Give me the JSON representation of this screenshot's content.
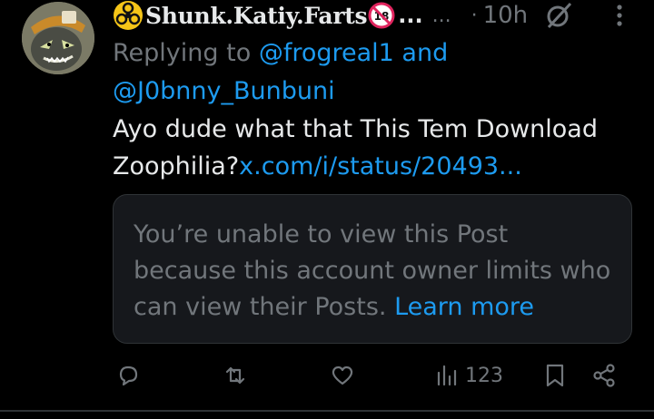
{
  "post": {
    "author_name": "Shunk.Katiy.Farts",
    "name_ellipsis": "...",
    "handle_ellipsis": "...",
    "separator": "·",
    "time": "10h",
    "replying_prefix": "Replying to ",
    "mention_1": "@frogreal1",
    "and_word": " and",
    "mention_2": "@J0bnny_Bunbuni",
    "text": "Ayo dude what that This Tem Download Zoophilia?",
    "link": "x.com/i/status/20493...",
    "icons": [
      "biohazard-icon",
      "age-18-icon",
      "grok-icon",
      "more-icon"
    ]
  },
  "restricted_card": {
    "message": "You’re unable to view this Post because this account owner limits who can view their Posts. ",
    "learn_more": "Learn more"
  },
  "actions": {
    "views": "123",
    "icons": [
      "reply-icon",
      "repost-icon",
      "like-icon",
      "views-icon",
      "bookmark-icon",
      "share-icon"
    ]
  },
  "colors": {
    "background": "#000000",
    "text": "#e7e9ea",
    "secondary": "#71767b",
    "link": "#1d9bf0",
    "card_bg": "#16181c"
  }
}
